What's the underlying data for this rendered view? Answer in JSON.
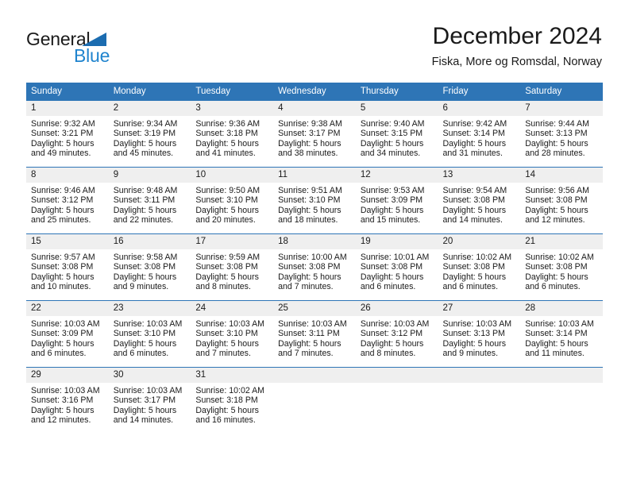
{
  "brand": {
    "name_top": "General",
    "name_bottom": "Blue",
    "triangle_color": "#1b6cb0",
    "accent_color": "#2084ce"
  },
  "header": {
    "title": "December 2024",
    "subtitle": "Fiska, More og Romsdal, Norway"
  },
  "theme": {
    "header_row_bg": "#2e75b6",
    "daynum_bg": "#efefef",
    "text_color": "#1a1a1a",
    "cell_bg": "#ffffff"
  },
  "calendar": {
    "columns": [
      "Sunday",
      "Monday",
      "Tuesday",
      "Wednesday",
      "Thursday",
      "Friday",
      "Saturday"
    ],
    "labels": {
      "sunrise": "Sunrise:",
      "sunset": "Sunset:",
      "daylight": "Daylight:"
    },
    "weeks": [
      [
        {
          "day": "1",
          "sunrise": "Sunrise: 9:32 AM",
          "sunset": "Sunset: 3:21 PM",
          "daylight_line1": "Daylight: 5 hours",
          "daylight_line2": "and 49 minutes."
        },
        {
          "day": "2",
          "sunrise": "Sunrise: 9:34 AM",
          "sunset": "Sunset: 3:19 PM",
          "daylight_line1": "Daylight: 5 hours",
          "daylight_line2": "and 45 minutes."
        },
        {
          "day": "3",
          "sunrise": "Sunrise: 9:36 AM",
          "sunset": "Sunset: 3:18 PM",
          "daylight_line1": "Daylight: 5 hours",
          "daylight_line2": "and 41 minutes."
        },
        {
          "day": "4",
          "sunrise": "Sunrise: 9:38 AM",
          "sunset": "Sunset: 3:17 PM",
          "daylight_line1": "Daylight: 5 hours",
          "daylight_line2": "and 38 minutes."
        },
        {
          "day": "5",
          "sunrise": "Sunrise: 9:40 AM",
          "sunset": "Sunset: 3:15 PM",
          "daylight_line1": "Daylight: 5 hours",
          "daylight_line2": "and 34 minutes."
        },
        {
          "day": "6",
          "sunrise": "Sunrise: 9:42 AM",
          "sunset": "Sunset: 3:14 PM",
          "daylight_line1": "Daylight: 5 hours",
          "daylight_line2": "and 31 minutes."
        },
        {
          "day": "7",
          "sunrise": "Sunrise: 9:44 AM",
          "sunset": "Sunset: 3:13 PM",
          "daylight_line1": "Daylight: 5 hours",
          "daylight_line2": "and 28 minutes."
        }
      ],
      [
        {
          "day": "8",
          "sunrise": "Sunrise: 9:46 AM",
          "sunset": "Sunset: 3:12 PM",
          "daylight_line1": "Daylight: 5 hours",
          "daylight_line2": "and 25 minutes."
        },
        {
          "day": "9",
          "sunrise": "Sunrise: 9:48 AM",
          "sunset": "Sunset: 3:11 PM",
          "daylight_line1": "Daylight: 5 hours",
          "daylight_line2": "and 22 minutes."
        },
        {
          "day": "10",
          "sunrise": "Sunrise: 9:50 AM",
          "sunset": "Sunset: 3:10 PM",
          "daylight_line1": "Daylight: 5 hours",
          "daylight_line2": "and 20 minutes."
        },
        {
          "day": "11",
          "sunrise": "Sunrise: 9:51 AM",
          "sunset": "Sunset: 3:10 PM",
          "daylight_line1": "Daylight: 5 hours",
          "daylight_line2": "and 18 minutes."
        },
        {
          "day": "12",
          "sunrise": "Sunrise: 9:53 AM",
          "sunset": "Sunset: 3:09 PM",
          "daylight_line1": "Daylight: 5 hours",
          "daylight_line2": "and 15 minutes."
        },
        {
          "day": "13",
          "sunrise": "Sunrise: 9:54 AM",
          "sunset": "Sunset: 3:08 PM",
          "daylight_line1": "Daylight: 5 hours",
          "daylight_line2": "and 14 minutes."
        },
        {
          "day": "14",
          "sunrise": "Sunrise: 9:56 AM",
          "sunset": "Sunset: 3:08 PM",
          "daylight_line1": "Daylight: 5 hours",
          "daylight_line2": "and 12 minutes."
        }
      ],
      [
        {
          "day": "15",
          "sunrise": "Sunrise: 9:57 AM",
          "sunset": "Sunset: 3:08 PM",
          "daylight_line1": "Daylight: 5 hours",
          "daylight_line2": "and 10 minutes."
        },
        {
          "day": "16",
          "sunrise": "Sunrise: 9:58 AM",
          "sunset": "Sunset: 3:08 PM",
          "daylight_line1": "Daylight: 5 hours",
          "daylight_line2": "and 9 minutes."
        },
        {
          "day": "17",
          "sunrise": "Sunrise: 9:59 AM",
          "sunset": "Sunset: 3:08 PM",
          "daylight_line1": "Daylight: 5 hours",
          "daylight_line2": "and 8 minutes."
        },
        {
          "day": "18",
          "sunrise": "Sunrise: 10:00 AM",
          "sunset": "Sunset: 3:08 PM",
          "daylight_line1": "Daylight: 5 hours",
          "daylight_line2": "and 7 minutes."
        },
        {
          "day": "19",
          "sunrise": "Sunrise: 10:01 AM",
          "sunset": "Sunset: 3:08 PM",
          "daylight_line1": "Daylight: 5 hours",
          "daylight_line2": "and 6 minutes."
        },
        {
          "day": "20",
          "sunrise": "Sunrise: 10:02 AM",
          "sunset": "Sunset: 3:08 PM",
          "daylight_line1": "Daylight: 5 hours",
          "daylight_line2": "and 6 minutes."
        },
        {
          "day": "21",
          "sunrise": "Sunrise: 10:02 AM",
          "sunset": "Sunset: 3:08 PM",
          "daylight_line1": "Daylight: 5 hours",
          "daylight_line2": "and 6 minutes."
        }
      ],
      [
        {
          "day": "22",
          "sunrise": "Sunrise: 10:03 AM",
          "sunset": "Sunset: 3:09 PM",
          "daylight_line1": "Daylight: 5 hours",
          "daylight_line2": "and 6 minutes."
        },
        {
          "day": "23",
          "sunrise": "Sunrise: 10:03 AM",
          "sunset": "Sunset: 3:10 PM",
          "daylight_line1": "Daylight: 5 hours",
          "daylight_line2": "and 6 minutes."
        },
        {
          "day": "24",
          "sunrise": "Sunrise: 10:03 AM",
          "sunset": "Sunset: 3:10 PM",
          "daylight_line1": "Daylight: 5 hours",
          "daylight_line2": "and 7 minutes."
        },
        {
          "day": "25",
          "sunrise": "Sunrise: 10:03 AM",
          "sunset": "Sunset: 3:11 PM",
          "daylight_line1": "Daylight: 5 hours",
          "daylight_line2": "and 7 minutes."
        },
        {
          "day": "26",
          "sunrise": "Sunrise: 10:03 AM",
          "sunset": "Sunset: 3:12 PM",
          "daylight_line1": "Daylight: 5 hours",
          "daylight_line2": "and 8 minutes."
        },
        {
          "day": "27",
          "sunrise": "Sunrise: 10:03 AM",
          "sunset": "Sunset: 3:13 PM",
          "daylight_line1": "Daylight: 5 hours",
          "daylight_line2": "and 9 minutes."
        },
        {
          "day": "28",
          "sunrise": "Sunrise: 10:03 AM",
          "sunset": "Sunset: 3:14 PM",
          "daylight_line1": "Daylight: 5 hours",
          "daylight_line2": "and 11 minutes."
        }
      ],
      [
        {
          "day": "29",
          "sunrise": "Sunrise: 10:03 AM",
          "sunset": "Sunset: 3:16 PM",
          "daylight_line1": "Daylight: 5 hours",
          "daylight_line2": "and 12 minutes."
        },
        {
          "day": "30",
          "sunrise": "Sunrise: 10:03 AM",
          "sunset": "Sunset: 3:17 PM",
          "daylight_line1": "Daylight: 5 hours",
          "daylight_line2": "and 14 minutes."
        },
        {
          "day": "31",
          "sunrise": "Sunrise: 10:02 AM",
          "sunset": "Sunset: 3:18 PM",
          "daylight_line1": "Daylight: 5 hours",
          "daylight_line2": "and 16 minutes."
        },
        {
          "day": "",
          "sunrise": "",
          "sunset": "",
          "daylight_line1": "",
          "daylight_line2": "",
          "empty": true
        },
        {
          "day": "",
          "sunrise": "",
          "sunset": "",
          "daylight_line1": "",
          "daylight_line2": "",
          "empty": true
        },
        {
          "day": "",
          "sunrise": "",
          "sunset": "",
          "daylight_line1": "",
          "daylight_line2": "",
          "empty": true
        },
        {
          "day": "",
          "sunrise": "",
          "sunset": "",
          "daylight_line1": "",
          "daylight_line2": "",
          "empty": true
        }
      ]
    ]
  }
}
